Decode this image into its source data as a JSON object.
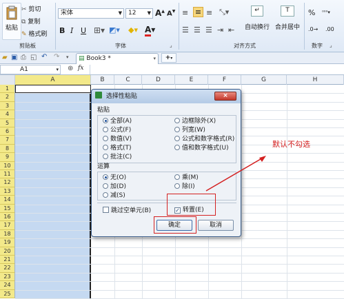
{
  "ribbon": {
    "paste_label": "粘贴",
    "cut_label": "剪切",
    "copy_label": "复制",
    "format_painter_label": "格式刷",
    "clipboard_group": "剪贴板",
    "font_name": "宋体",
    "font_size": "12",
    "font_group": "字体",
    "wrap_label": "自动换行",
    "merge_label": "合并居中",
    "align_group": "对齐方式",
    "number_group": "数字",
    "percent": "%",
    "comma": "000"
  },
  "qat": {
    "tab_title": "Book3 *",
    "add_tab": "+"
  },
  "formula_bar": {
    "name_box": "A1",
    "fx": "fx"
  },
  "grid": {
    "columns": [
      "A",
      "B",
      "C",
      "D",
      "E",
      "F",
      "G",
      "H"
    ],
    "rows": [
      "1",
      "2",
      "3",
      "4",
      "5",
      "6",
      "7",
      "8",
      "9",
      "10",
      "11",
      "12",
      "13",
      "14",
      "15",
      "16",
      "17",
      "18",
      "19",
      "20",
      "21",
      "22",
      "23",
      "24",
      "25"
    ]
  },
  "dialog": {
    "title": "选择性粘贴",
    "paste_section": "粘贴",
    "paste_options": [
      {
        "label": "全部(A)",
        "selected": true
      },
      {
        "label": "公式(F)",
        "selected": false
      },
      {
        "label": "数值(V)",
        "selected": false
      },
      {
        "label": "格式(T)",
        "selected": false
      },
      {
        "label": "批注(C)",
        "selected": false
      },
      {
        "label": "边框除外(X)",
        "selected": false
      },
      {
        "label": "列宽(W)",
        "selected": false
      },
      {
        "label": "公式和数字格式(R)",
        "selected": false
      },
      {
        "label": "值和数字格式(U)",
        "selected": false
      }
    ],
    "op_section": "运算",
    "op_options": [
      {
        "label": "无(O)",
        "selected": true
      },
      {
        "label": "加(D)",
        "selected": false
      },
      {
        "label": "减(S)",
        "selected": false
      },
      {
        "label": "乘(M)",
        "selected": false
      },
      {
        "label": "除(I)",
        "selected": false
      }
    ],
    "skip_blanks": "跳过空单元(B)",
    "transpose": "转置(E)",
    "ok": "确定",
    "cancel": "取消",
    "close": "×"
  },
  "annotation": {
    "text": "默认不勾选",
    "color": "#d42020"
  },
  "colors": {
    "selection": "#c5d9f1",
    "header_highlight": "#f3e98a"
  }
}
